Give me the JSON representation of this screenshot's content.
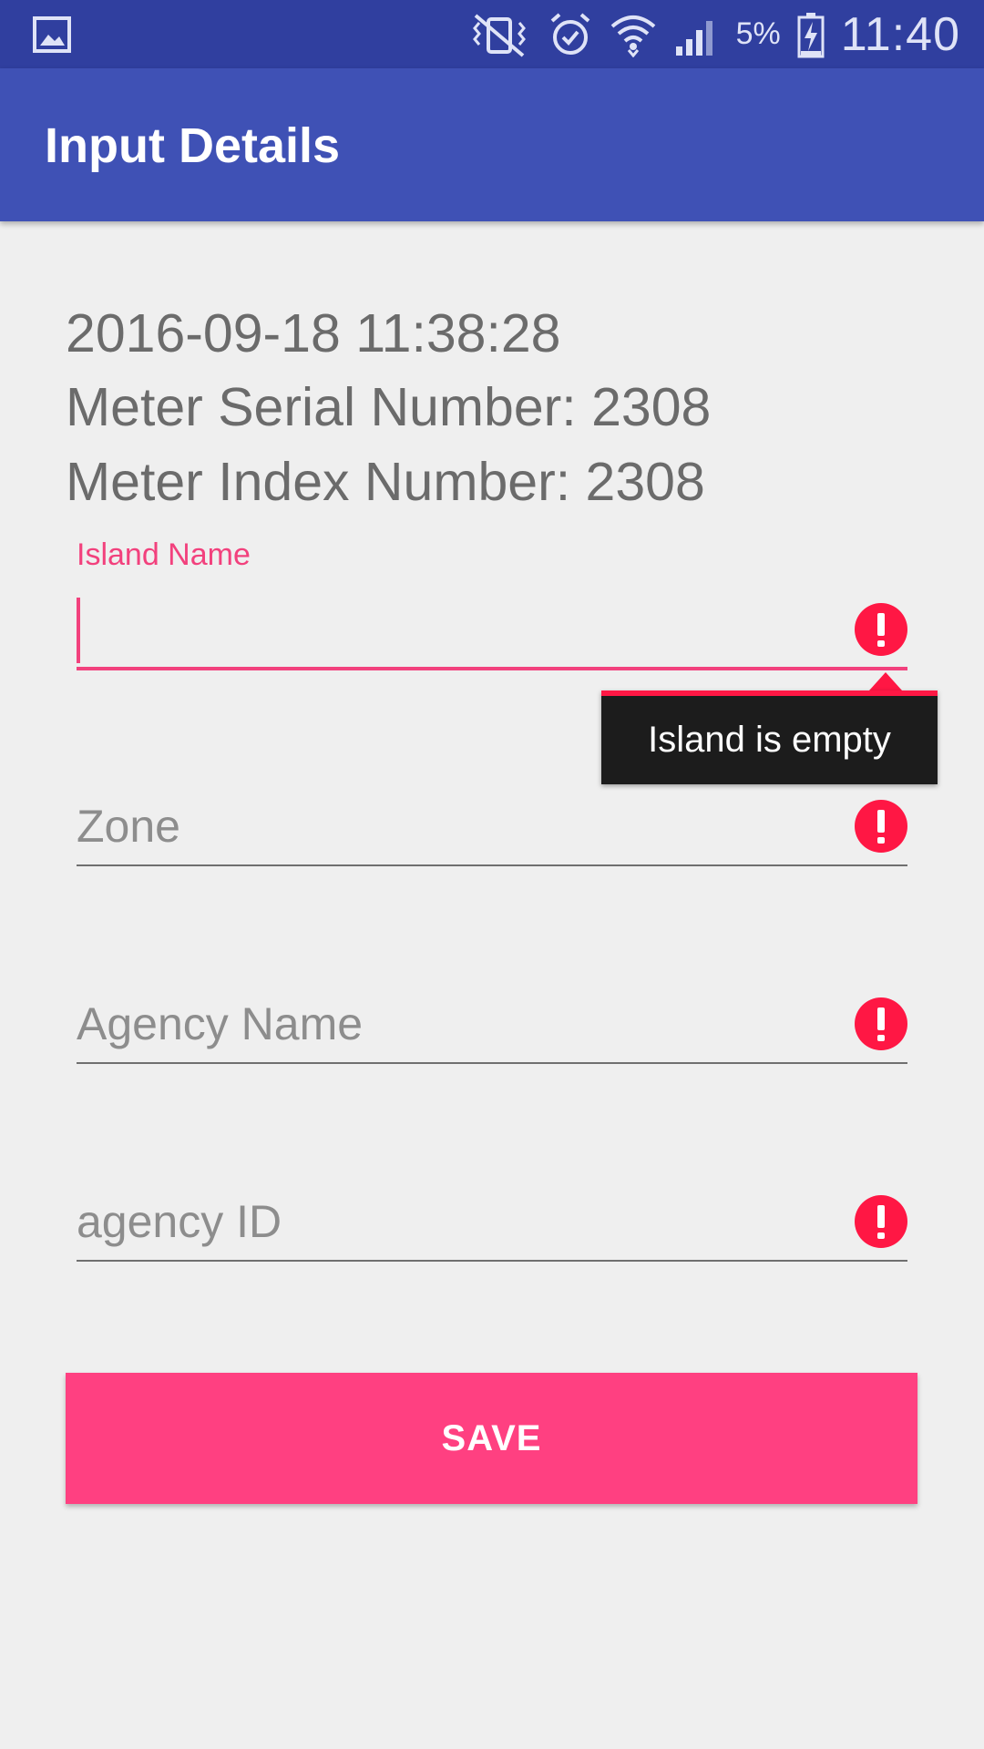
{
  "status_bar": {
    "battery_percent": "5%",
    "time": "11:40",
    "icons": [
      "gallery-icon",
      "vibrate-icon",
      "alarm-icon",
      "wifi-icon",
      "signal-icon",
      "battery-charging-icon"
    ]
  },
  "app_bar": {
    "title": "Input Details"
  },
  "info": {
    "datetime": "2016-09-18 11:38:28",
    "meter_serial": "Meter Serial Number: 2308",
    "meter_index": "Meter Index Number: 2308"
  },
  "form": {
    "island": {
      "label": "Island Name",
      "value": "",
      "error": "Island is empty"
    },
    "zone": {
      "placeholder": "Zone"
    },
    "agency_name": {
      "placeholder": "Agency Name"
    },
    "agency_id": {
      "placeholder": "agency ID"
    }
  },
  "save_label": "SAVE",
  "colors": {
    "status_bar": "#303f9f",
    "app_bar": "#3f51b5",
    "accent": "#ff4081",
    "error": "#ff1744",
    "background": "#efefef"
  }
}
